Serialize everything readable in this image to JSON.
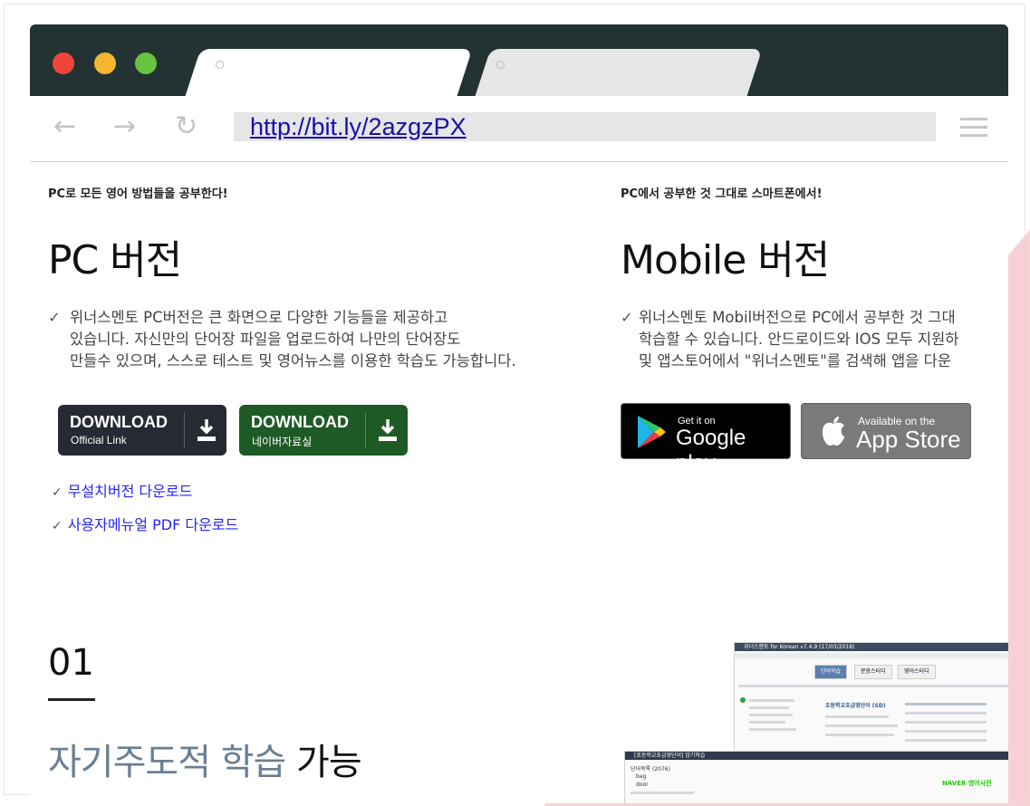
{
  "browser": {
    "url": "http://bit.ly/2azgzPX",
    "nav": {
      "back": "←",
      "forward": "→",
      "reload": "↻"
    }
  },
  "pc": {
    "tagline": "PC로 모든 영어 방법들을 공부한다!",
    "title": "PC 버전",
    "description_lines": [
      "위너스멘토 PC버전은 큰 화면으로 다양한 기능들을 제공하고",
      "있습니다. 자신만의 단어장 파일을 업로드하여 나만의 단어장도",
      "만들수 있으며, 스스로 테스트 및 영어뉴스를 이용한 학습도 가능합니다."
    ],
    "btn_official": {
      "label": "DOWNLOAD",
      "sub": "Official Link",
      "color": "#262a33"
    },
    "btn_naver": {
      "label": "DOWNLOAD",
      "sub": "네이버자료실",
      "color": "#1e5a26"
    },
    "links": [
      "무설치버전 다운로드",
      "사용자메뉴얼 PDF 다운로드"
    ]
  },
  "mobile": {
    "tagline": "PC에서 공부한 것 그대로 스마트폰에서!",
    "title": "Mobile 버전",
    "description_lines": [
      "위너스멘토 Mobil버전으로 PC에서 공부한 것 그대",
      "학습할 수 있습니다. 안드로이드와 IOS 모두 지원하",
      "및 앱스토어에서 \"위너스멘토\"를 검색해 앱을 다운"
    ],
    "google_play": {
      "small": "Get it on",
      "big": "Google play"
    },
    "app_store": {
      "small": "Available on the",
      "big": "App Store"
    }
  },
  "section": {
    "number": "01",
    "title_highlight": "자기주도적 학습",
    "title_rest": " 가능"
  },
  "thumb": {
    "window_title": "위너스멘토 for Korean v7.4.9 (17/03/2018)",
    "tabs": [
      "단어학습",
      "문장스터디",
      "영어스터디"
    ],
    "heading": "초등학교초급영단어 (SD)",
    "second_window_title": "[초등학교초급영단어] 암기학습",
    "list_header": "단어목록 (2076)",
    "words": [
      "bag",
      "door"
    ],
    "naver_label": "NAVER 영어사전"
  },
  "colors": {
    "accent_blue": "#2525ff",
    "title_gray_blue": "#6a7f94",
    "browser_dark": "#233233"
  }
}
